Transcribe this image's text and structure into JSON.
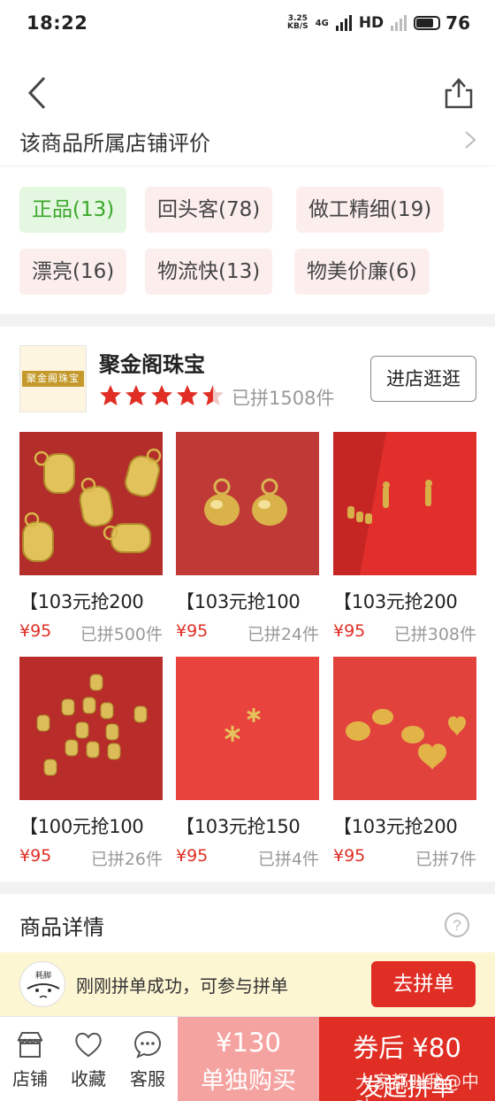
{
  "status": {
    "time": "18:22",
    "net_speed_top": "3.25",
    "net_speed_bottom": "KB/S",
    "network": "4G",
    "hd": "HD",
    "battery": "76"
  },
  "reviews": {
    "title": "该商品所属店铺评价",
    "tags": [
      {
        "label": "正品(13)",
        "active": true
      },
      {
        "label": "回头客(78)",
        "active": false
      },
      {
        "label": "做工精细(19)",
        "active": false
      },
      {
        "label": "漂亮(16)",
        "active": false
      },
      {
        "label": "物流快(13)",
        "active": false
      },
      {
        "label": "物美价廉(6)",
        "active": false
      }
    ]
  },
  "shop": {
    "logo_text": "聚金阁珠宝",
    "name": "聚金阁珠宝",
    "rating": 4.5,
    "sold_total": "已拼1508件",
    "enter_label": "进店逛逛"
  },
  "products": [
    {
      "title": "【103元抢200",
      "price": "¥95",
      "sold": "已拼500件",
      "icon": "gold-tag-charms"
    },
    {
      "title": "【103元抢100",
      "price": "¥95",
      "sold": "已拼24件",
      "icon": "gold-bell-charms"
    },
    {
      "title": "【103元抢200",
      "price": "¥95",
      "sold": "已拼308件",
      "icon": "gold-mini-figures"
    },
    {
      "title": "【100元抢100",
      "price": "¥95",
      "sold": "已拼26件",
      "icon": "gold-small-tags"
    },
    {
      "title": "【103元抢150",
      "price": "¥95",
      "sold": "已拼4件",
      "icon": "gold-snowflakes"
    },
    {
      "title": "【103元抢200",
      "price": "¥95",
      "sold": "已拼7件",
      "icon": "gold-heart-beads"
    }
  ],
  "details": {
    "title": "商品详情",
    "help_icon": "question-icon"
  },
  "group_banner": {
    "avatar_text": "耗脚",
    "text": "刚刚拼单成功，可参与拼单",
    "button": "去拼单"
  },
  "bottom_bar": {
    "tabs": [
      {
        "label": "店铺",
        "icon": "shop-icon"
      },
      {
        "label": "收藏",
        "icon": "heart-icon"
      },
      {
        "label": "客服",
        "icon": "chat-icon"
      }
    ],
    "single_price": "¥130",
    "single_label": "单独购买",
    "group_price": "券后 ¥80",
    "group_label": "发起拼单"
  },
  "watermark": "大家都叫我@中叶",
  "colors": {
    "accent_red": "#e02e24",
    "light_red": "#f5a3a0",
    "tag_green": "#3aa82a",
    "banner_yellow": "#fdf6d3"
  }
}
